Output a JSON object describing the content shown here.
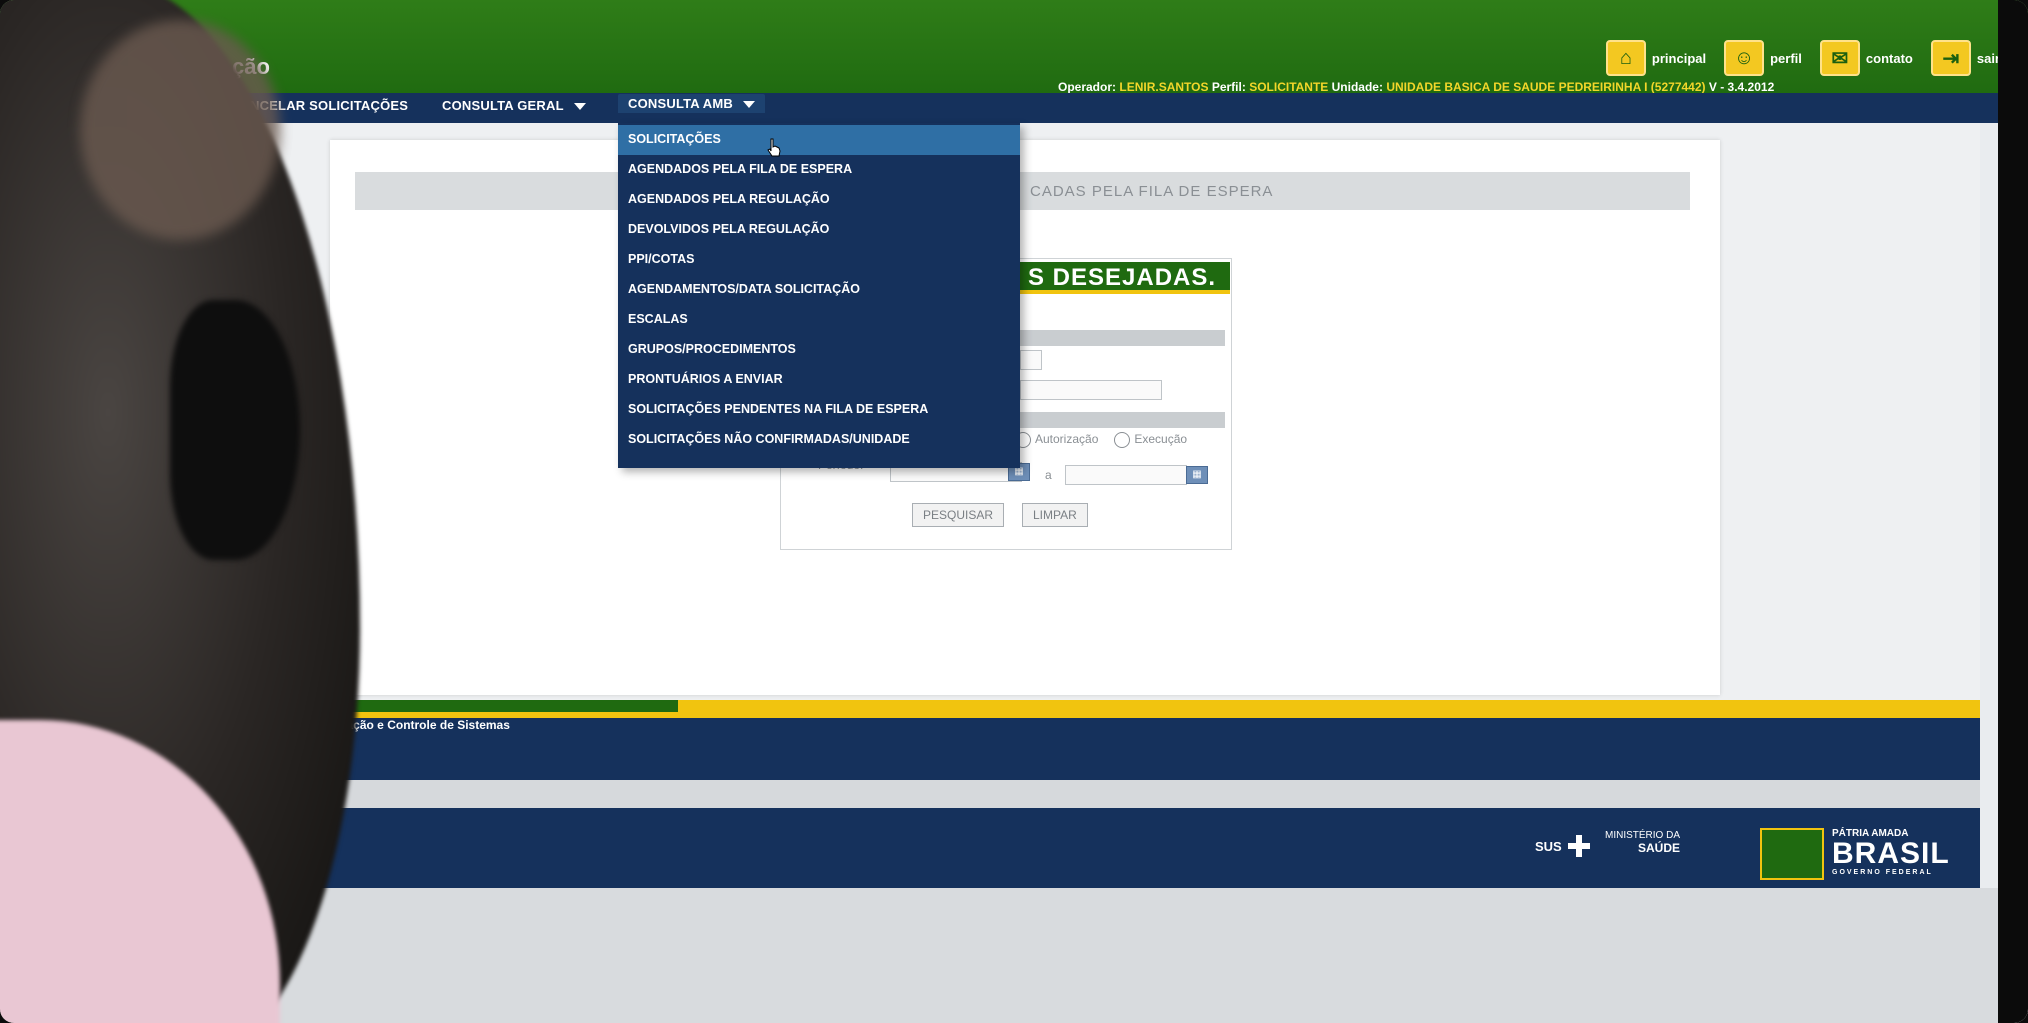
{
  "header": {
    "app_title": "ção",
    "operator_label": "Operador:",
    "operator_value": "LENIR.SANTOS",
    "profile_label": "Perfil:",
    "profile_value": "SOLICITANTE",
    "unit_label": "Unidade:",
    "unit_value": "UNIDADE BASICA DE SAUDE PEDREIRINHA I (5277442)",
    "version": "V - 3.4.2012",
    "links": [
      {
        "label": "principal",
        "icon": "home-icon"
      },
      {
        "label": "perfil",
        "icon": "user-icon"
      },
      {
        "label": "contato",
        "icon": "mail-icon"
      },
      {
        "label": "sair",
        "icon": "exit-icon"
      }
    ]
  },
  "menu": {
    "items": [
      {
        "label": "NCELAR SOLICITAÇÕES"
      },
      {
        "label": "CONSULTA GERAL"
      },
      {
        "label": "CONSULTA AMB"
      }
    ]
  },
  "dropdown": {
    "items": [
      "SOLICITAÇÕES",
      "AGENDADOS PELA FILA DE ESPERA",
      "AGENDADOS PELA REGULAÇÃO",
      "DEVOLVIDOS PELA REGULAÇÃO",
      "PPI/COTAS",
      "AGENDAMENTOS/DATA SOLICITAÇÃO",
      "ESCALAS",
      "GRUPOS/PROCEDIMENTOS",
      "PRONTUÁRIOS A ENVIAR",
      "SOLICITAÇÕES PENDENTES NA FILA DE ESPERA",
      "SOLICITAÇÕES NÃO CONFIRMADAS/UNIDADE"
    ]
  },
  "panel": {
    "header_text": "CADAS PELA FILA DE ESPERA",
    "form_title": "S DESEJADAS.",
    "radio_autorizacao": "Autorização",
    "radio_execucao": "Execução",
    "periodo_label": "Período:",
    "a_label": "a",
    "search_button": "PESQUISAR",
    "clear_button": "LIMPAR"
  },
  "footer": {
    "department": "Departamento de Regulação, Avaliação e Controle de Sistemas",
    "sus": "SUS",
    "ministerio_line1": "MINISTÉRIO DA",
    "ministerio_line2": "SAÚDE",
    "brasil_small": "PÁTRIA AMADA",
    "brasil_big": "BRASIL",
    "brasil_tiny": "GOVERNO FEDERAL"
  }
}
